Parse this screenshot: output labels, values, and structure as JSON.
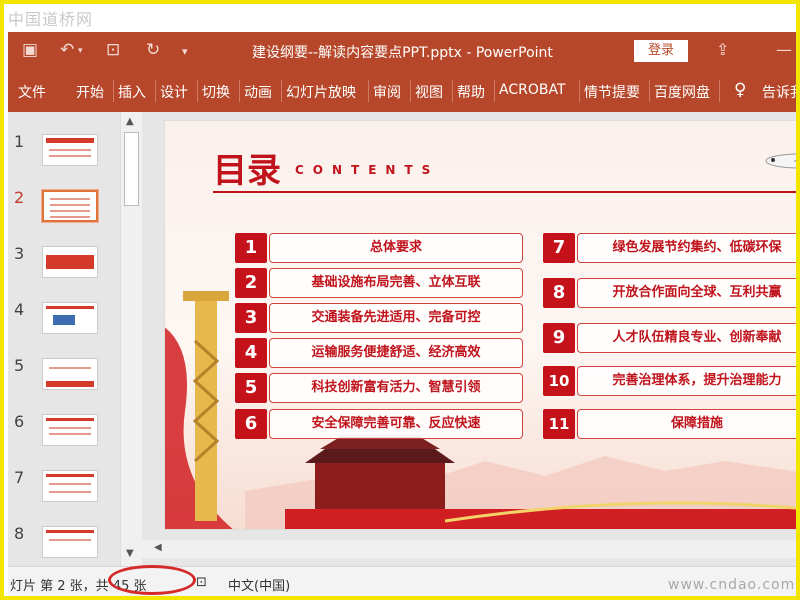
{
  "watermark_top": "中国道桥网",
  "watermark_bottom": "www.cndao.com",
  "titlebar": {
    "title": "建设纲要--解读内容要点PPT.pptx  -  PowerPoint",
    "login_label": "登录"
  },
  "ribbon": {
    "tabs": [
      "文件",
      "开始",
      "插入",
      "设计",
      "切换",
      "动画",
      "幻灯片放映",
      "审阅",
      "视图",
      "帮助",
      "ACROBAT",
      "情节提要",
      "百度网盘",
      "告诉我"
    ]
  },
  "thumbnails": {
    "numbers": [
      "1",
      "2",
      "3",
      "4",
      "5",
      "6",
      "7",
      "8"
    ],
    "active_index": 1
  },
  "slide": {
    "heading": "目录",
    "subheading": "CONTENTS",
    "items_left": [
      {
        "num": "1",
        "text": "总体要求"
      },
      {
        "num": "2",
        "text": "基础设施布局完善、立体互联"
      },
      {
        "num": "3",
        "text": "交通装备先进适用、完备可控"
      },
      {
        "num": "4",
        "text": "运输服务便捷舒适、经济高效"
      },
      {
        "num": "5",
        "text": "科技创新富有活力、智慧引领"
      },
      {
        "num": "6",
        "text": "安全保障完善可靠、反应快速"
      }
    ],
    "items_right": [
      {
        "num": "7",
        "text": "绿色发展节约集约、低碳环保"
      },
      {
        "num": "8",
        "text": "开放合作面向全球、互利共赢"
      },
      {
        "num": "9",
        "text": "人才队伍精良专业、创新奉献"
      },
      {
        "num": "10",
        "text": "完善治理体系，提升治理能力"
      },
      {
        "num": "11",
        "text": "保障措施"
      }
    ],
    "colors": {
      "accent": "#c5121a",
      "ribbon": "#b7472a"
    }
  },
  "statusbar": {
    "slide_info": "灯片 第 2 张，共 45 张",
    "language": "中文(中国)"
  }
}
